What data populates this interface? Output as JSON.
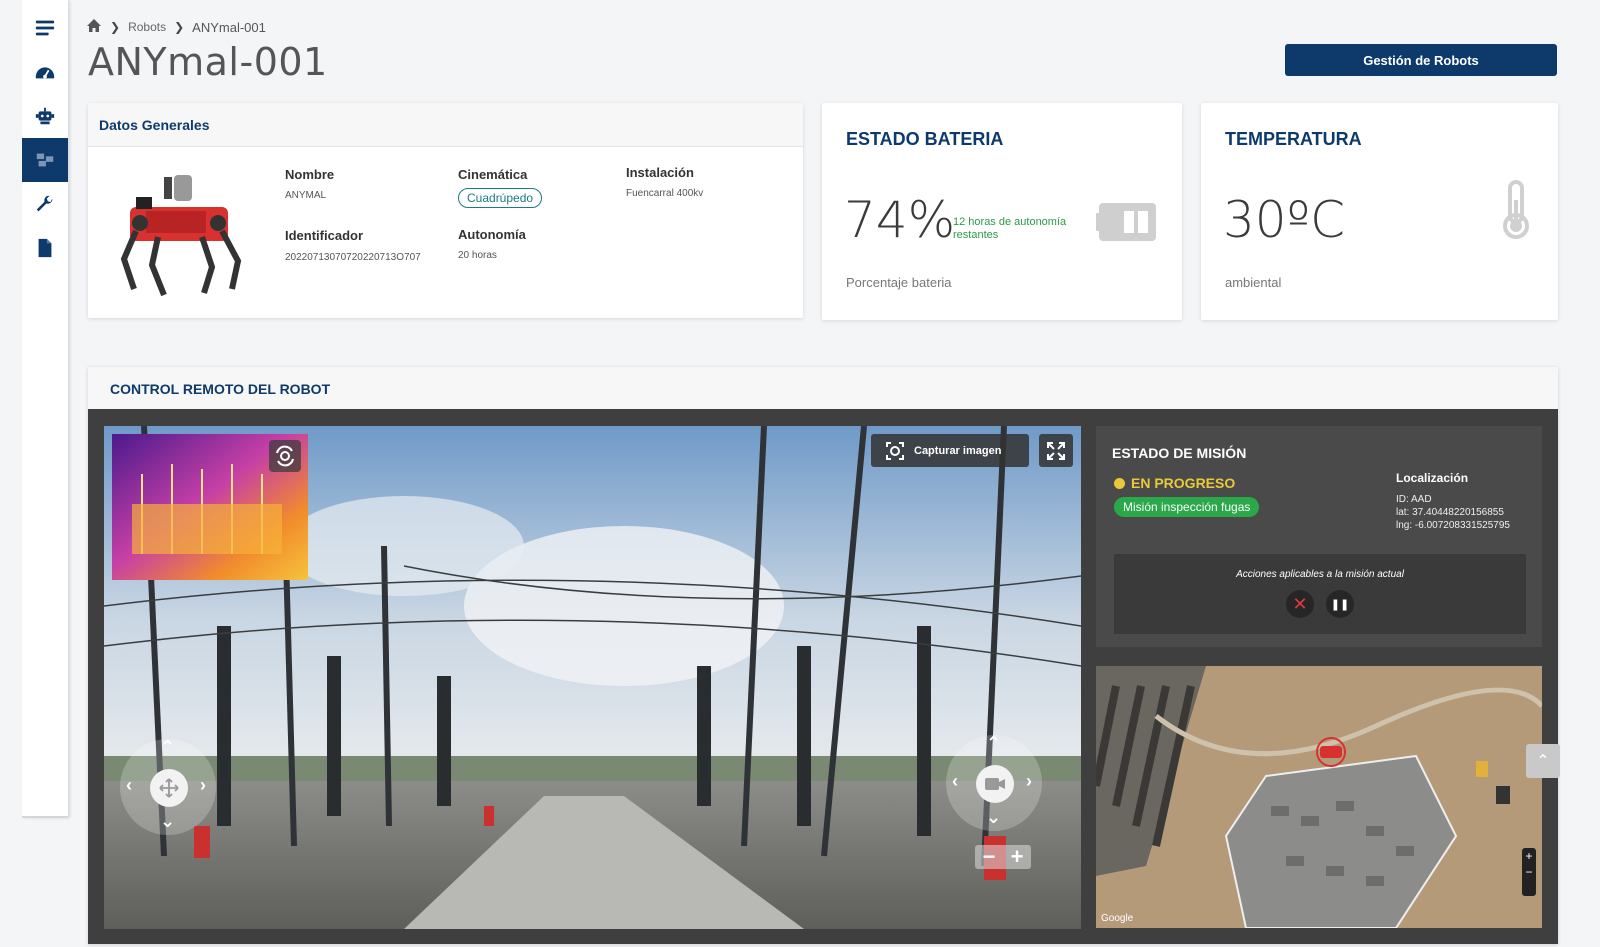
{
  "sidebar": {
    "items": [
      {
        "icon": "menu-icon"
      },
      {
        "icon": "dashboard-icon"
      },
      {
        "icon": "robot-icon"
      },
      {
        "icon": "robots-fleet-icon",
        "active": true
      },
      {
        "icon": "wrench-icon"
      },
      {
        "icon": "document-icon"
      }
    ]
  },
  "breadcrumb": {
    "home_icon": "home-icon",
    "items": [
      "Robots",
      "ANYmal-001"
    ]
  },
  "page": {
    "title": "ANYmal-001",
    "primary_button": "Gestión de Robots"
  },
  "general": {
    "title": "Datos Generales",
    "nombre_label": "Nombre",
    "nombre_value": "ANYMAL",
    "cinematica_label": "Cinemática",
    "cinematica_value": "Cuadrúpedo",
    "instalacion_label": "Instalación",
    "instalacion_value": "Fuencarral 400kv",
    "identificador_label": "Identificador",
    "identificador_value": "20220713070720220713O707",
    "autonomia_label": "Autonomía",
    "autonomia_value": "20 horas"
  },
  "battery": {
    "title": "ESTADO BATERIA",
    "value": "74%",
    "level": 0.74,
    "note": "12 horas de autonomía restantes",
    "sub": "Porcentaje bateria"
  },
  "temperature": {
    "title": "TEMPERATURA",
    "value": "30ºC",
    "sub": "ambiental"
  },
  "remote": {
    "title": "CONTROL REMOTO DEL ROBOT",
    "capture_label": "Capturar imagen",
    "zoom_minus": "−",
    "zoom_plus": "+"
  },
  "mission": {
    "title": "ESTADO DE MISIÓN",
    "status": "EN PROGRESO",
    "tag": "Misión inspección fugas",
    "location_label": "Localización",
    "id": "ID: AAD",
    "lat": "lat: 37.40448220156855",
    "lng": "lng: -6.007208331525795",
    "actions_label": "Acciones aplicables a la misión actual",
    "cancel_symbol": "✕",
    "pause_symbol": "❚❚"
  },
  "map": {
    "credit": "Google"
  },
  "colors": {
    "primary": "#0d3a6b",
    "success": "#2aa84a",
    "warning": "#e9c93b",
    "danger": "#e03a3a"
  }
}
